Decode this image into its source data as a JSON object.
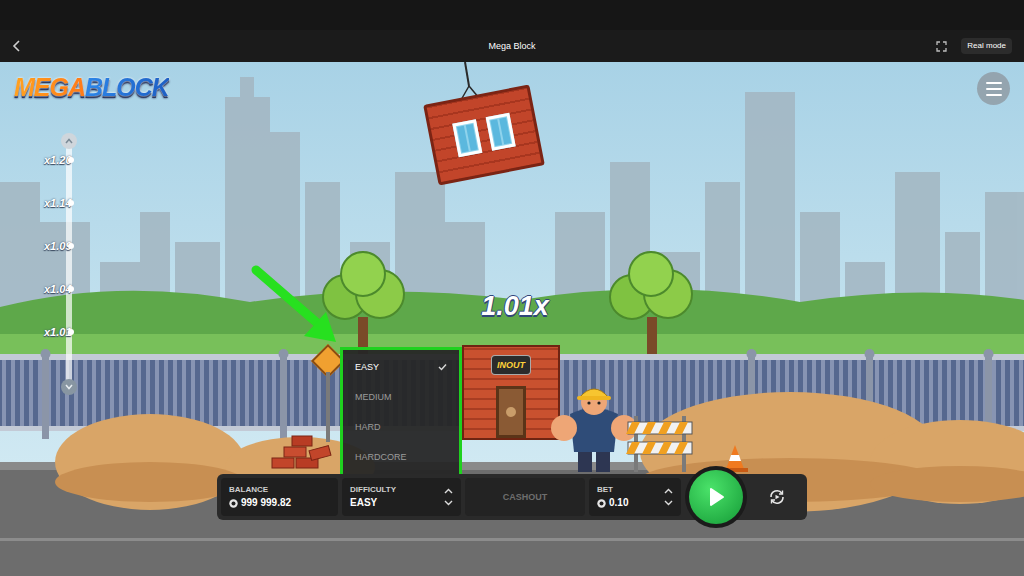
{
  "window": {
    "title": "Mega Block",
    "mode": "Real mode"
  },
  "logo": "MEGABLOCK",
  "multiplier_scale": [
    "x1.20",
    "x1.14",
    "x1.09",
    "x1.04",
    "x1.01"
  ],
  "current_multiplier": "1.01x",
  "building_sign": "INOUT",
  "difficulty_menu": {
    "open": true,
    "items": [
      {
        "label": "EASY",
        "selected": true
      },
      {
        "label": "MEDIUM",
        "selected": false
      },
      {
        "label": "HARD",
        "selected": false
      },
      {
        "label": "HARDCORE",
        "selected": false
      }
    ]
  },
  "controls": {
    "balance": {
      "label": "BALANCE",
      "value": "999 999.82"
    },
    "difficulty": {
      "label": "DIFFICULTY",
      "value": "EASY"
    },
    "cashout": {
      "label": "CASHOUT",
      "disabled": true
    },
    "bet": {
      "label": "BET",
      "value": "0.10"
    }
  }
}
